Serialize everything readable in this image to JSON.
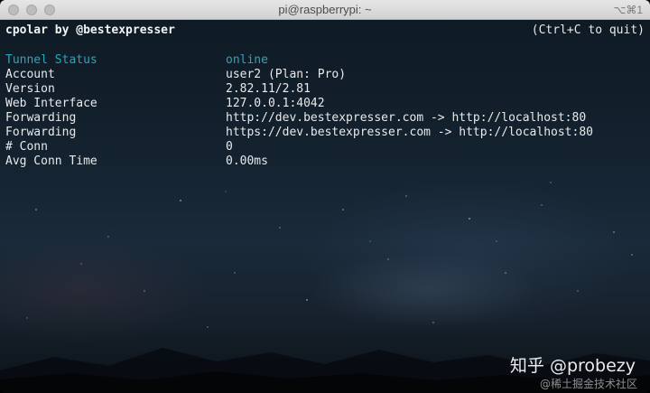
{
  "window": {
    "title": "pi@raspberrypi: ~",
    "shortcut": "⌥⌘1"
  },
  "terminal": {
    "header_left": "cpolar by @bestexpresser",
    "header_right": "(Ctrl+C to quit)",
    "rows": [
      {
        "label": "Tunnel Status",
        "value": "online"
      },
      {
        "label": "Account",
        "value": "user2 (Plan: Pro)"
      },
      {
        "label": "Version",
        "value": "2.82.11/2.81"
      },
      {
        "label": "Web Interface",
        "value": "127.0.0.1:4042"
      },
      {
        "label": "Forwarding",
        "value": "http://dev.bestexpresser.com -> http://localhost:80"
      },
      {
        "label": "Forwarding",
        "value": "https://dev.bestexpresser.com -> http://localhost:80"
      },
      {
        "label": "# Conn",
        "value": "0"
      },
      {
        "label": "Avg Conn Time",
        "value": "0.00ms"
      }
    ]
  },
  "watermark": {
    "main": "知乎 @probezy",
    "sub": "@稀土掘金技术社区"
  },
  "colors": {
    "status_accent": "#2aa6b8",
    "text": "#e9e9e9"
  }
}
